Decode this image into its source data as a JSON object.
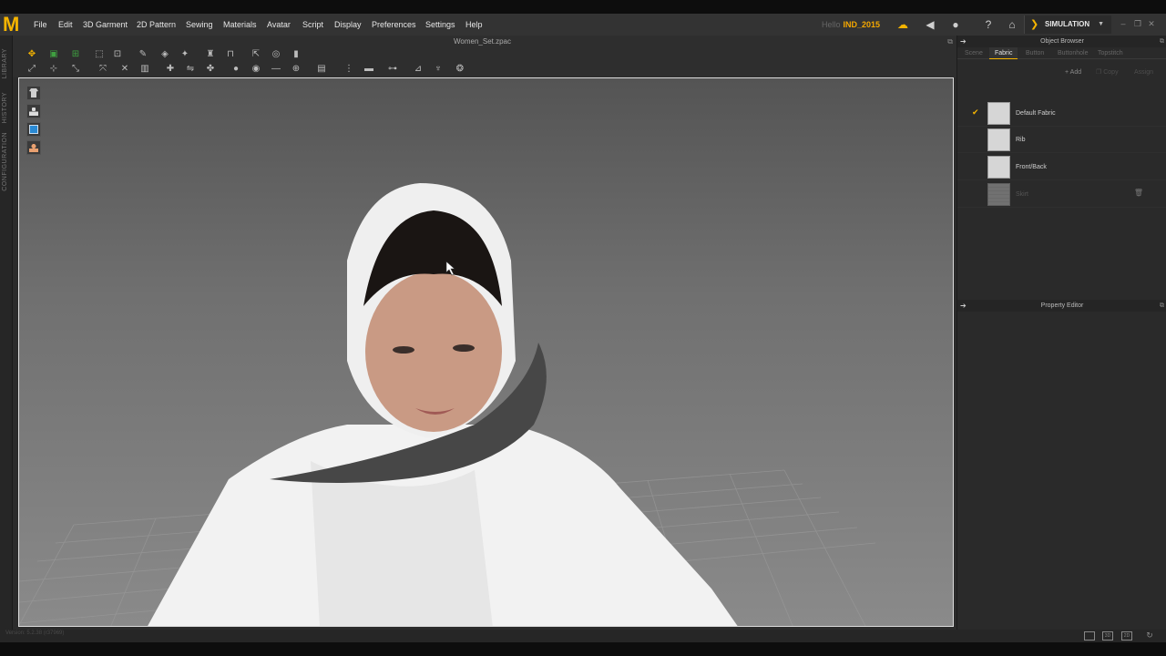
{
  "app": {
    "logo": "M",
    "menu": [
      "File",
      "Edit",
      "3D Garment",
      "2D Pattern",
      "Sewing",
      "Materials",
      "Avatar",
      "Script",
      "Display",
      "Preferences",
      "Settings",
      "Help"
    ],
    "user_id_prefix": "Hello",
    "user_id": "IND_2015",
    "mode_label": "SIMULATION",
    "accent_color": "#f5b400"
  },
  "left_tabs": [
    "LIBRARY",
    "HISTORY",
    "CONFIGURATION"
  ],
  "toolbar": {
    "file_title": "Women_Set.zpac"
  },
  "viewport": {
    "buttons": [
      "garment-view-icon",
      "avatar-view-icon",
      "texture-view-icon",
      "skin-view-icon"
    ]
  },
  "object_browser": {
    "title": "Object Browser",
    "tabs": [
      "Scene",
      "Fabric",
      "Button",
      "Buttonhole",
      "Topstitch"
    ],
    "active_tab": "Fabric",
    "actions": {
      "add": "Add",
      "copy": "Copy",
      "assign": "Assign"
    },
    "fabrics": [
      {
        "name": "Default Fabric",
        "selected": true,
        "dim": false
      },
      {
        "name": "Rib",
        "selected": false,
        "dim": false
      },
      {
        "name": "Front/Back",
        "selected": false,
        "dim": false
      },
      {
        "name": "Skirt",
        "selected": false,
        "dim": true
      }
    ]
  },
  "property_editor": {
    "title": "Property Editor"
  },
  "status": {
    "version": "Version: 5.2.38     (r37969)"
  }
}
